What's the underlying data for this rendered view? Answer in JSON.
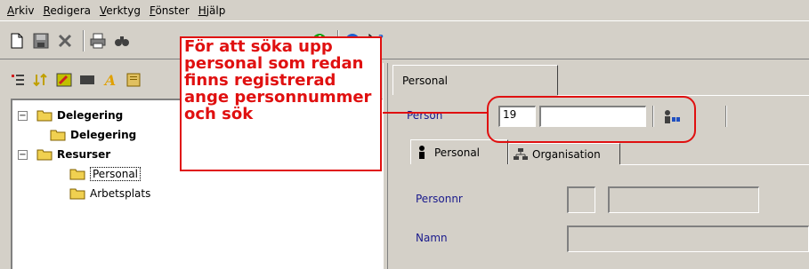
{
  "menubar": {
    "items": [
      {
        "first": "A",
        "rest": "rkiv"
      },
      {
        "first": "R",
        "rest": "edigera"
      },
      {
        "first": "V",
        "rest": "erktyg"
      },
      {
        "first": "F",
        "rest": "önster"
      },
      {
        "first": "H",
        "rest": "jälp"
      }
    ]
  },
  "toolbar": {
    "buttons": [
      "new-document-icon",
      "save-icon",
      "delete-icon",
      "print-icon",
      "find-icon",
      "info-icon",
      "help-icon",
      "whats-this-icon"
    ]
  },
  "left_toolbar": {
    "buttons": [
      "list-icon",
      "sort-icon",
      "edit-icon",
      "rectangle-icon",
      "font-icon",
      "report-icon"
    ]
  },
  "tree": {
    "items": [
      {
        "label": "Delegering",
        "bold": true,
        "expander": "−"
      },
      {
        "label": "Delegering",
        "bold": true
      },
      {
        "label": "Resurser",
        "bold": true,
        "expander": "−"
      },
      {
        "label": "Personal",
        "selected": true
      },
      {
        "label": "Arbetsplats"
      }
    ]
  },
  "main_tab": {
    "label": "Personal"
  },
  "person_search": {
    "label": "Person",
    "prefix_value": "19",
    "number_value": "",
    "search_icon": "person-search-icon"
  },
  "subtabs": [
    {
      "label": "Personal",
      "icon": "person-icon",
      "active": true
    },
    {
      "label": "Organisation",
      "icon": "org-chart-icon",
      "active": false
    }
  ],
  "form": {
    "personnr_label": "Personnr",
    "namn_label": "Namn"
  },
  "callout": {
    "text": "För att söka upp personal som redan finns registrerad ange personnummer och sök",
    "color": "#e01010"
  },
  "colors": {
    "window_bg": "#d4d0c8",
    "label_blue": "#1a1a8c",
    "callout_red": "#e01010"
  }
}
